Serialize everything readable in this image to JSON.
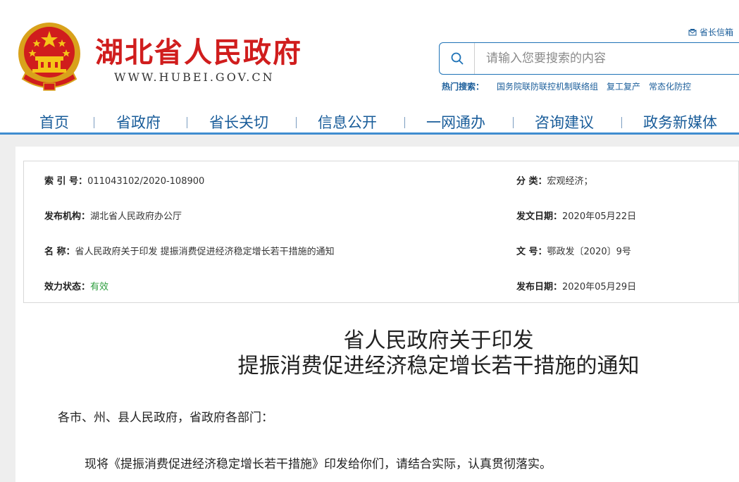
{
  "header": {
    "site_title": "湖北省人民政府",
    "site_url": "WWW.HUBEI.GOV.CN",
    "mailbox_label": "省长信箱",
    "search_placeholder": "请输入您要搜索的内容",
    "hot_label": "热门搜索：",
    "hot_links": [
      "国务院联防联控机制联络组",
      "复工复产",
      "常态化防控"
    ]
  },
  "nav": {
    "items": [
      "首页",
      "省政府",
      "省长关切",
      "信息公开",
      "一网通办",
      "咨询建议",
      "政务新媒体"
    ]
  },
  "meta": {
    "index_key": "索 引 号：",
    "index_val": "011043102/2020-108900",
    "category_key": "分 类：",
    "category_val": "宏观经济；",
    "publisher_key": "发布机构：",
    "publisher_val": "湖北省人民政府办公厅",
    "issue_date_key": "发文日期：",
    "issue_date_val": "2020年05月22日",
    "name_key": "名 称：",
    "name_val": "省人民政府关于印发 提振消费促进经济稳定增长若干措施的通知",
    "doc_no_key": "文 号：",
    "doc_no_val": "鄂政发〔2020〕9号",
    "status_key": "效力状态：",
    "status_val": "有效",
    "publish_date_key": "发布日期：",
    "publish_date_val": "2020年05月29日"
  },
  "doc": {
    "title_line1": "省人民政府关于印发",
    "title_line2": "提振消费促进经济稳定增长若干措施的通知",
    "salutation": "各市、州、县人民政府，省政府各部门：",
    "body_p1": "现将《提振消费促进经济稳定增长若干措施》印发给你们，请结合实际，认真贯彻落实。"
  },
  "colors": {
    "brand_red": "#d01d1d",
    "nav_blue": "#1a5d9a",
    "accent_blue": "#3f8dd0",
    "status_green": "#2e9e3f"
  }
}
